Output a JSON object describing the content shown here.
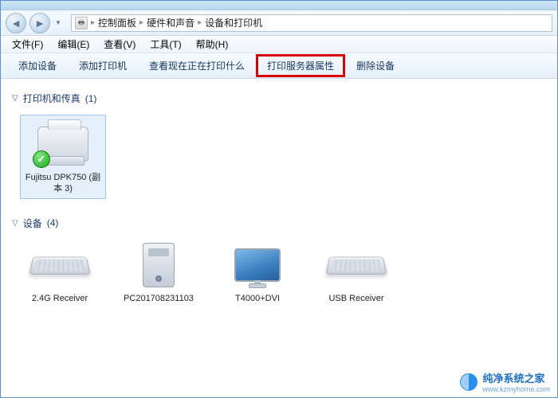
{
  "breadcrumb": {
    "parts": [
      "控制面板",
      "硬件和声音",
      "设备和打印机"
    ]
  },
  "menubar": {
    "file": "文件(F)",
    "edit": "编辑(E)",
    "view": "查看(V)",
    "tools": "工具(T)",
    "help": "帮助(H)"
  },
  "toolbar": {
    "add_device": "添加设备",
    "add_printer": "添加打印机",
    "see_whats_printing": "查看现在正在打印什么",
    "print_server_properties": "打印服务器属性",
    "remove_device": "删除设备"
  },
  "groups": {
    "printers": {
      "title": "打印机和传真",
      "count": "(1)"
    },
    "devices": {
      "title": "设备",
      "count": "(4)"
    }
  },
  "printers": [
    {
      "name": "Fujitsu DPK750 (副本 3)",
      "default": true
    }
  ],
  "devices": [
    {
      "name": "2.4G Receiver",
      "kind": "keyboard"
    },
    {
      "name": "PC201708231103",
      "kind": "pc"
    },
    {
      "name": "T4000+DVI",
      "kind": "monitor"
    },
    {
      "name": "USB Receiver",
      "kind": "keyboard"
    }
  ],
  "watermark": {
    "title": "纯净系统之家",
    "url": "www.kzmyhome.com"
  }
}
